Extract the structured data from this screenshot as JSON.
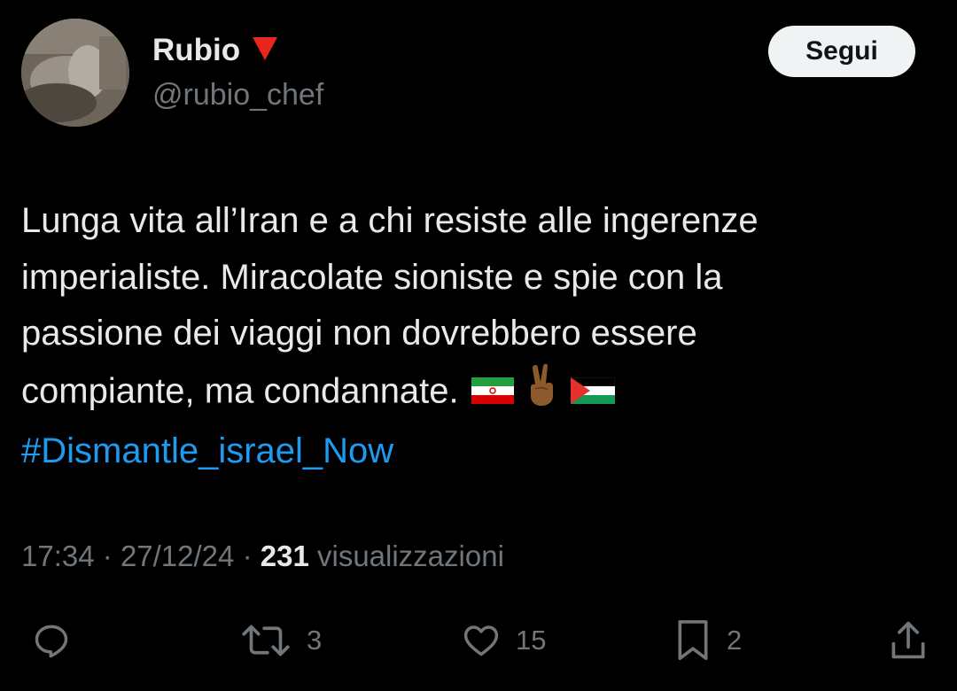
{
  "author": {
    "display_name": "Rubio",
    "handle": "@rubio_chef",
    "badge_icon": "red-down-triangle-icon",
    "badge_color": "#e8261c"
  },
  "follow_button": {
    "label": "Segui"
  },
  "tweet": {
    "lines": [
      "Lunga vita all’Iran e a chi resiste alle ingerenze",
      "imperialiste. Miracolate sioniste e spie con la",
      "passione dei viaggi non dovrebbero essere",
      "compiante, ma condannate."
    ],
    "emojis": [
      "iran-flag-icon",
      "victory-hand-icon",
      "palestine-flag-icon"
    ],
    "hashtag": "#Dismantle_israel_Now"
  },
  "meta": {
    "time": "17:34",
    "separator": "·",
    "date": "27/12/24",
    "views_count": "231",
    "views_label": "visualizzazioni"
  },
  "actions": {
    "reply": {
      "icon": "reply-icon",
      "count": ""
    },
    "retweet": {
      "icon": "retweet-icon",
      "count": "3"
    },
    "like": {
      "icon": "heart-icon",
      "count": "15"
    },
    "bookmark": {
      "icon": "bookmark-icon",
      "count": "2"
    },
    "share": {
      "icon": "share-icon",
      "count": ""
    }
  },
  "colors": {
    "background": "#000000",
    "text": "#e7e9ea",
    "secondary_text": "#71767b",
    "link": "#1d9bf0",
    "follow_button_bg": "#eff3f4"
  }
}
